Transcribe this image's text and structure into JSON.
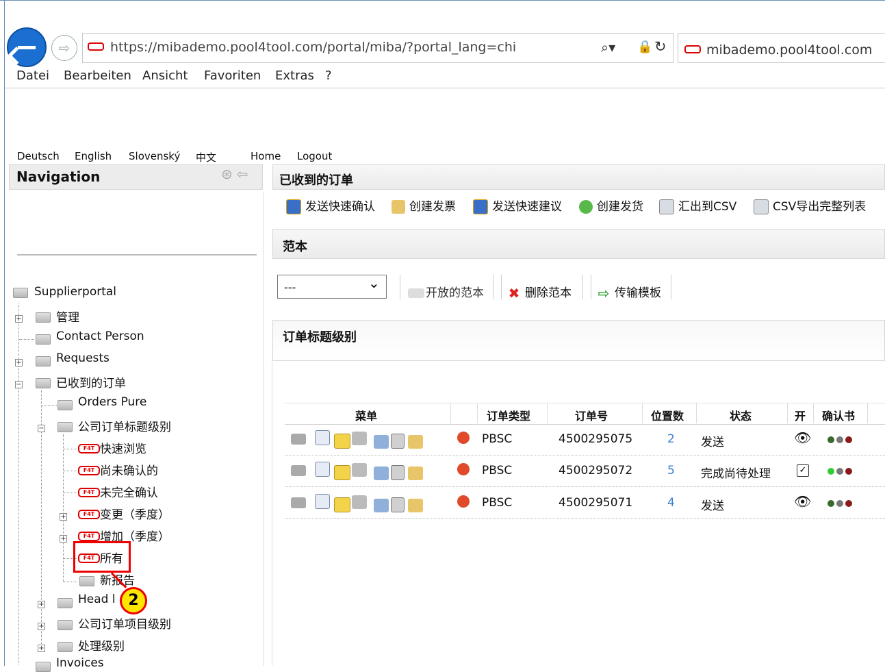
{
  "browser": {
    "url": "https://mibademo.pool4tool.com/portal/miba/?portal_lang=chi",
    "tab_title": "mibademo.pool4tool.com",
    "menu": [
      "Datei",
      "Bearbeiten",
      "Ansicht",
      "Favoriten",
      "Extras",
      "?"
    ]
  },
  "top_links": [
    "Deutsch",
    "English",
    "Slovenský",
    "中文",
    "Home",
    "Logout"
  ],
  "nav": {
    "title": "Navigation",
    "tree": [
      "Supplierportal",
      "管理",
      "Contact Person",
      "Requests",
      "已收到的订单",
      "Orders Pure",
      "公司订单标题级别",
      "快速浏览",
      "尚未确认的",
      "未完全确认",
      "变更（季度）",
      "增加（季度）",
      "所有",
      "新报告",
      "Head l",
      "公司订单项目级别",
      "处理级别",
      "Invoices"
    ]
  },
  "callout": "2",
  "main": {
    "title": "已收到的订单",
    "toolbar": [
      "发送快速确认",
      "创建发票",
      "发送快速建议",
      "创建发货",
      "汇出到CSV",
      "CSV导出完整列表"
    ],
    "template": {
      "title": "范本",
      "select_value": "---",
      "buttons": [
        "开放的范本",
        "删除范本",
        "传输模板"
      ]
    },
    "orders": {
      "title": "订单标题级别",
      "columns": [
        "菜单",
        "订单类型",
        "订单号",
        "位置数",
        "状态",
        "开",
        "确认书"
      ],
      "rows": [
        {
          "type": "PBSC",
          "number": "4500295075",
          "positions": "2",
          "status": "发送"
        },
        {
          "type": "PBSC",
          "number": "4500295072",
          "positions": "5",
          "status": "完成尚待处理"
        },
        {
          "type": "PBSC",
          "number": "4500295071",
          "positions": "4",
          "status": "发送"
        }
      ]
    }
  }
}
